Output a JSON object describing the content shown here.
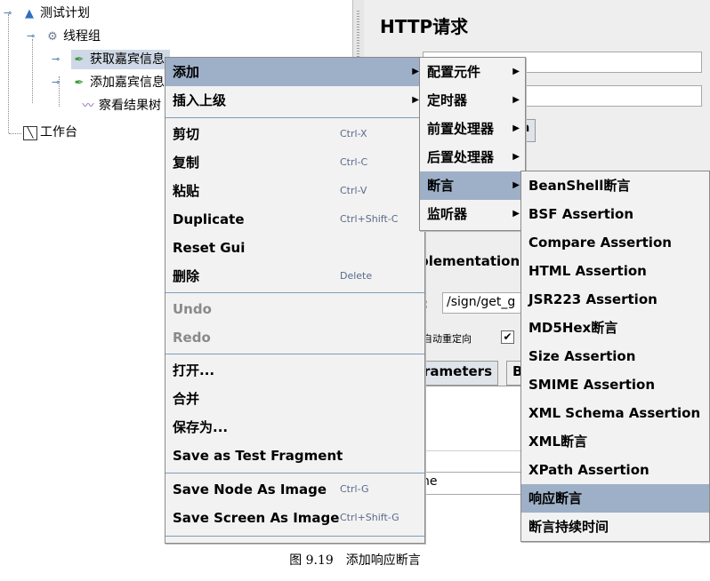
{
  "tree": {
    "test_plan": "测试计划",
    "thread_group": "线程组",
    "sampler1": "获取嘉宾信息",
    "sampler2": "添加嘉宾信息",
    "listener": "察看结果树",
    "workbench": "工作台"
  },
  "panel": {
    "title": "HTTP请求",
    "tab_fragment": "n",
    "implementation_label": "plementation:",
    "path_label": ":",
    "path_value": "/sign/get_g",
    "redirect_label": "自动重定向",
    "redirect_checked": "✔",
    "params_tab": "rameters",
    "body_tab": "B",
    "name_fragment": "ne"
  },
  "context_menu": {
    "items": [
      {
        "label": "添加",
        "shortcut": "",
        "submenu": true,
        "highlighted": true
      },
      {
        "label": "插入上级",
        "shortcut": "",
        "submenu": true
      },
      {
        "label": "剪切",
        "shortcut": "Ctrl-X"
      },
      {
        "label": "复制",
        "shortcut": "Ctrl-C"
      },
      {
        "label": "粘贴",
        "shortcut": "Ctrl-V"
      },
      {
        "label": "Duplicate",
        "shortcut": "Ctrl+Shift-C"
      },
      {
        "label": "Reset Gui",
        "shortcut": ""
      },
      {
        "label": "删除",
        "shortcut": "Delete"
      },
      {
        "label": "Undo",
        "shortcut": "",
        "disabled": true
      },
      {
        "label": "Redo",
        "shortcut": "",
        "disabled": true
      },
      {
        "label": "打开...",
        "shortcut": ""
      },
      {
        "label": "合并",
        "shortcut": ""
      },
      {
        "label": "保存为...",
        "shortcut": ""
      },
      {
        "label": "Save as Test Fragment",
        "shortcut": ""
      },
      {
        "label": "Save Node As Image",
        "shortcut": "Ctrl-G"
      },
      {
        "label": "Save Screen As Image",
        "shortcut": "Ctrl+Shift-G"
      }
    ]
  },
  "add_submenu": {
    "items": [
      {
        "label": "配置元件"
      },
      {
        "label": "定时器"
      },
      {
        "label": "前置处理器"
      },
      {
        "label": "后置处理器"
      },
      {
        "label": "断言",
        "highlighted": true
      },
      {
        "label": "监听器"
      }
    ]
  },
  "assertion_submenu": {
    "items": [
      {
        "label": "BeanShell断言"
      },
      {
        "label": "BSF Assertion"
      },
      {
        "label": "Compare Assertion"
      },
      {
        "label": "HTML Assertion"
      },
      {
        "label": "JSR223 Assertion"
      },
      {
        "label": "MD5Hex断言"
      },
      {
        "label": "Size Assertion"
      },
      {
        "label": "SMIME Assertion"
      },
      {
        "label": "XML Schema Assertion"
      },
      {
        "label": "XML断言"
      },
      {
        "label": "XPath Assertion"
      },
      {
        "label": "响应断言",
        "highlighted": true
      },
      {
        "label": "断言持续时间"
      }
    ]
  },
  "caption": "图 9.19　添加响应断言",
  "colors": {
    "highlight": "#9eb0c8",
    "menu_bg": "#f2f2f2",
    "shortcut": "#5a6a8a"
  }
}
